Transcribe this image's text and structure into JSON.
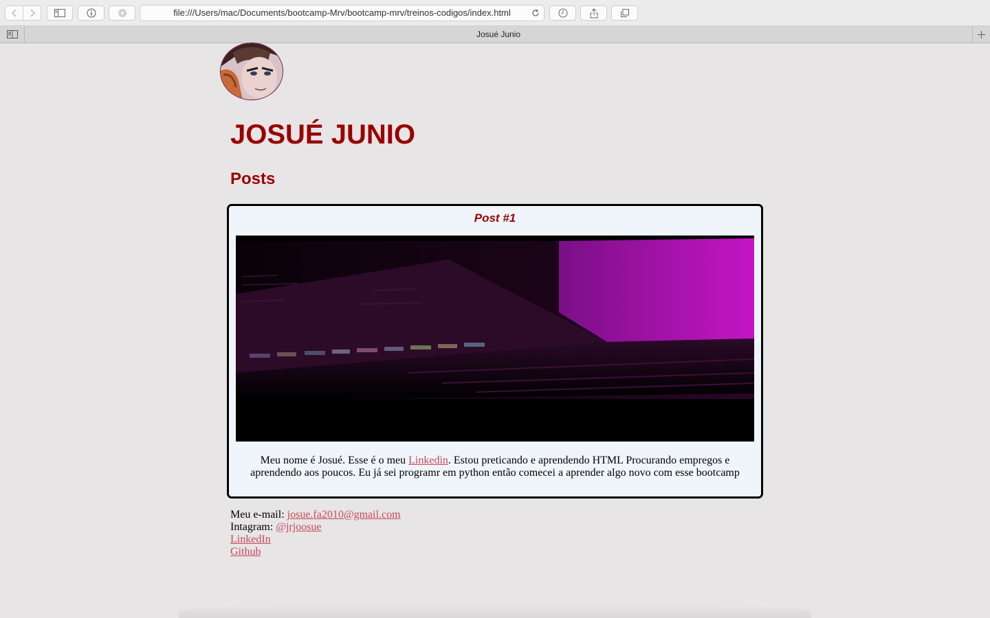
{
  "browser": {
    "url": "file:///Users/mac/Documents/bootcamp-Mrv/bootcamp-mrv/treinos-codigos/index.html",
    "tab_title": "Josué Junio"
  },
  "header": {
    "title": "JOSUÉ JUNIO"
  },
  "posts_section": {
    "title": "Posts"
  },
  "post": {
    "title": "Post #1",
    "text_before_link": "Meu nome é Josué. Esse é o meu ",
    "link_label": "Linkedin",
    "text_after_link": ". Estou preticando e aprendendo HTML Procurando empregos e aprendendo aos poucos. Eu já sei programr em python então comecei a aprender algo novo com esse bootcamp"
  },
  "contacts": {
    "email_label": "Meu e-mail: ",
    "email": "josue.fa2010@gmail.com",
    "instagram_label": "Intagram: ",
    "instagram": "@jrjoosue",
    "linkedin": "LinkedIn",
    "github": "Github"
  },
  "colors": {
    "heading": "#990000",
    "link": "#c5495a",
    "page_bg": "#e7e5e6",
    "post_bg": "#eff5fb"
  }
}
